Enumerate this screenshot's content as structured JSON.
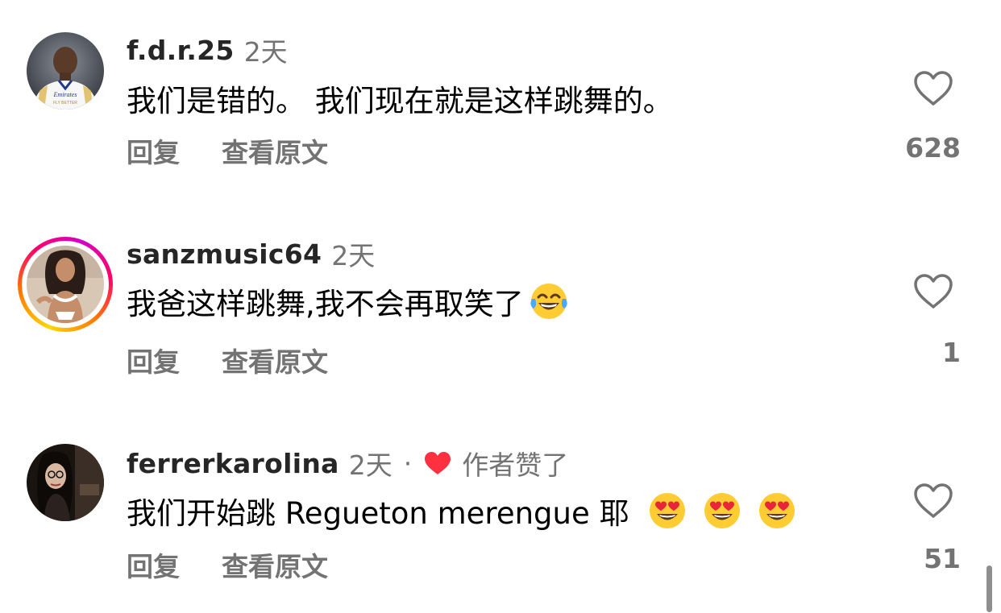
{
  "comments": [
    {
      "username": "f.d.r.25",
      "time": "2天",
      "text": "我们是错的。 我们现在就是这样跳舞的。",
      "reply_label": "回复",
      "translate_label": "查看原文",
      "like_count": "628",
      "jersey_text": "Emirates",
      "jersey_subtext": "FLY BETTER"
    },
    {
      "username": "sanzmusic64",
      "time": "2天",
      "text": "我爸这样跳舞,我不会再取笑了",
      "emoji": "face-with-tears-of-joy",
      "reply_label": "回复",
      "translate_label": "查看原文",
      "like_count": "1",
      "has_story": true
    },
    {
      "username": "ferrerkarolina",
      "time": "2天",
      "separator": "·",
      "author_liked": "作者赞了",
      "text": "我们开始跳 Regueton merengue 耶",
      "emoji": "smiling-face-with-heart-eyes",
      "emoji_count": 3,
      "reply_label": "回复",
      "translate_label": "查看原文",
      "like_count": "51"
    }
  ],
  "colors": {
    "liked_heart": "#ff3040",
    "secondary_text": "#737373"
  }
}
